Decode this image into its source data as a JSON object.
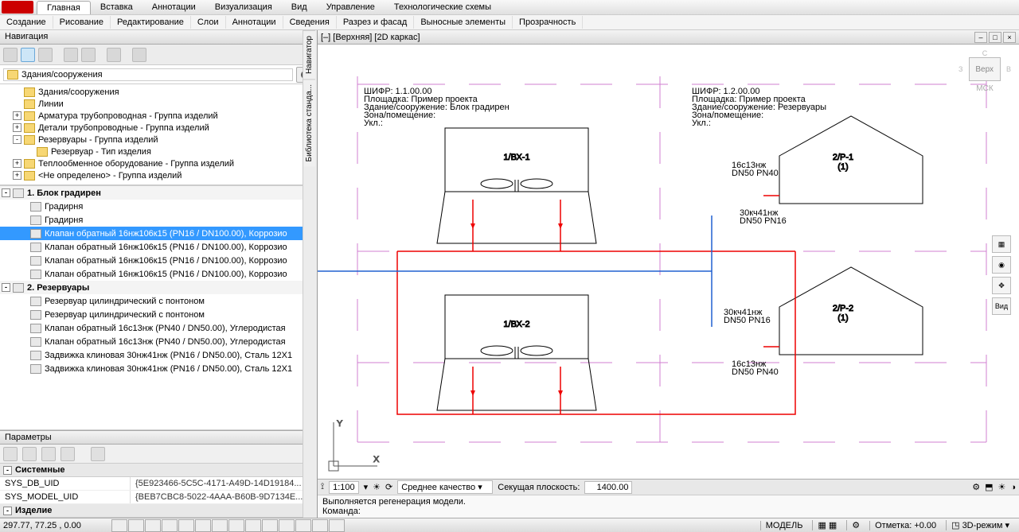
{
  "app": {
    "logo": "A"
  },
  "menu_tabs": [
    "Главная",
    "Вставка",
    "Аннотации",
    "Визуализация",
    "Вид",
    "Управление",
    "Технологические схемы"
  ],
  "menu_active_index": 0,
  "ribbon_groups": [
    "Создание",
    "Рисование",
    "Редактирование",
    "Слои",
    "Аннотации",
    "Сведения",
    "Разрез и фасад",
    "Выносные элементы",
    "Прозрачность"
  ],
  "left": {
    "nav_title": "Навигация",
    "search_value": "Здания/сооружения",
    "tree": [
      {
        "exp": "",
        "d": 1,
        "label": "Здания/сооружения",
        "ico": "folder"
      },
      {
        "exp": "",
        "d": 1,
        "label": "Линии",
        "ico": "folder"
      },
      {
        "exp": "+",
        "d": 1,
        "label": "Арматура трубопроводная  - Группа изделий",
        "ico": "folder"
      },
      {
        "exp": "+",
        "d": 1,
        "label": "Детали трубопроводные  - Группа изделий",
        "ico": "folder"
      },
      {
        "exp": "-",
        "d": 1,
        "label": "Резервуары  - Группа изделий",
        "ico": "folder"
      },
      {
        "exp": "",
        "d": 2,
        "label": "Резервуар  - Тип изделия",
        "ico": "folder"
      },
      {
        "exp": "+",
        "d": 1,
        "label": "Теплообменное оборудование  - Группа изделий",
        "ico": "folder"
      },
      {
        "exp": "+",
        "d": 1,
        "label": "<Не определено>  - Группа изделий",
        "ico": "folder"
      }
    ],
    "tree2": [
      {
        "type": "hdr",
        "exp": "-",
        "label": "1. Блок градирен"
      },
      {
        "type": "it",
        "label": "Градирня"
      },
      {
        "type": "it",
        "label": "Градирня"
      },
      {
        "type": "it",
        "label": "Клапан обратный 16нж106к15 (PN16 / DN100.00), Коррозио",
        "sel": true
      },
      {
        "type": "it",
        "label": "Клапан обратный 16нж106к15 (PN16 / DN100.00), Коррозио"
      },
      {
        "type": "it",
        "label": "Клапан обратный 16нж106к15 (PN16 / DN100.00), Коррозио"
      },
      {
        "type": "it",
        "label": "Клапан обратный 16нж106к15 (PN16 / DN100.00), Коррозио"
      },
      {
        "type": "hdr",
        "exp": "-",
        "label": "2. Резервуары"
      },
      {
        "type": "it",
        "label": "Резервуар цилиндрический с понтоном"
      },
      {
        "type": "it",
        "label": "Резервуар цилиндрический с понтоном"
      },
      {
        "type": "it",
        "label": "Клапан обратный 16с13нж (PN40 / DN50.00), Углеродистая"
      },
      {
        "type": "it",
        "label": "Клапан обратный 16с13нж (PN40 / DN50.00), Углеродистая"
      },
      {
        "type": "it",
        "label": "Задвижка клиновая 30нж41нж (PN16 / DN50.00), Сталь 12Х1"
      },
      {
        "type": "it",
        "label": "Задвижка клиновая 30нж41нж (PN16 / DN50.00), Сталь 12Х1"
      }
    ],
    "params_title": "Параметры",
    "params": {
      "categories": [
        {
          "name": "Системные",
          "rows": [
            {
              "k": "SYS_DB_UID",
              "v": "{5E923466-5C5C-4171-A49D-14D19184..."
            },
            {
              "k": "SYS_MODEL_UID",
              "v": "{BEB7CBC8-5022-4AAA-B60B-9D7134E..."
            }
          ]
        },
        {
          "name": "Изделие",
          "rows": []
        }
      ]
    },
    "side_tabs": [
      "Навигатор",
      "Библиотека станда..."
    ]
  },
  "drawing_window": {
    "title": "[–] [Верхняя] [2D каркас]",
    "labels": {
      "code1": "ШИФР: 1.1.00.00",
      "site1": "Площадка: Пример проекта",
      "bldg1": "Здание/сооружение: Блок градирен",
      "zone1": "Зона/помещение:",
      "level1": "Укл.:",
      "code2": "ШИФР: 1.2.00.00",
      "site2": "Площадка: Пример проекта",
      "bldg2": "Здание/сооружение: Резервуары",
      "zone2": "Зона/помещение:",
      "level2": "Укл.:",
      "box1": "1/ВХ-1",
      "box2": "1/ВХ-2",
      "tank1": "2/Р-1",
      "tank1s": "(1)",
      "tank2": "2/Р-2",
      "tank2s": "(1)",
      "valve1": "16с13нж",
      "valve1s": "DN50 PN40",
      "valve2": "30кч41нж",
      "valve2s": "DN50 PN16",
      "valve3": "30кч41нж",
      "valve3s": "DN50 PN16",
      "valve4": "16с13нж",
      "valve4s": "DN50 PN40"
    },
    "view_cube": {
      "face": "Верх",
      "coord": "МСК",
      "z": "З",
      "s": "С"
    },
    "nav_tool_label": "Вид",
    "status_row": {
      "scale_label": "1:100",
      "quality": "Среднее качество",
      "cutplane_label": "Секущая плоскость:",
      "cutplane_val": "1400.00"
    },
    "cmd": {
      "line1": "Выполняется регенерация модели.",
      "line2": "Команда:"
    }
  },
  "bottom": {
    "coords": "297.77, 77.25 , 0.00",
    "model": "МОДЕЛЬ",
    "elev_label": "Отметка:",
    "elev_val": "+0.00",
    "mode": "3D-режим"
  }
}
